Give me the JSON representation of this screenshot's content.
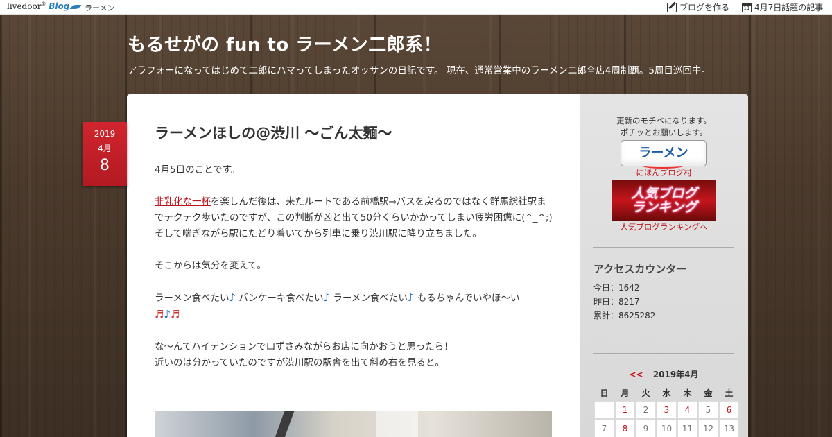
{
  "topbar": {
    "logo_text": "livedoor",
    "logo_blog": "Blog",
    "crumb": "ラーメン",
    "create_blog": "ブログを作る",
    "calendar_icon_day": "11",
    "topics": "4月7日話題の記事"
  },
  "header": {
    "title": "もるせがの fun to ラーメン二郎系！",
    "description": "アラフォーになってはじめて二郎にハマってしまったオッサンの日記です。 現在、通常営業中のラーメン二郎全店4周制覇。5周目巡回中。"
  },
  "date": {
    "year": "2019",
    "month": "4月",
    "day": "8"
  },
  "article": {
    "title": "ラーメンほしの@渋川 〜ごん太麺〜",
    "p1": "4月5日のことです。",
    "link": "非乳化な一杯",
    "p2_rest": "を楽しんだ後は、来たルートである前橋駅→バスを戻るのではなく群馬総社駅までテクテク歩いたのですが、この判断が凶と出て50分くらいかかってしまい疲労困憊に(^_^;)",
    "p3": "そして喘ぎながら駅にたどり着いてから列車に乗り渋川駅に降り立ちました。",
    "p4": "そこからは気分を変えて。",
    "sing1": "ラーメン食べたい",
    "sing2": " パンケーキ食べたい",
    "sing3": " ラーメン食べたい",
    "sing4": " もるちゃんでいやほ〜い",
    "p6": "な〜んてハイテンションで口ずさみながらお店に向かおうと思ったら！",
    "p7": "近いのは分かっていたのですが渋川駅の駅舎を出て斜め右を見ると。"
  },
  "sidebar": {
    "motive_line1": "更新のモチベになります。",
    "motive_line2": "ポチッとお願いします。",
    "ramen_button": "ラーメン",
    "nihon_blog_link": "にほんブログ村",
    "rank_banner_line1": "人気ブログ",
    "rank_banner_line2": "ランキング",
    "rank_link": "人気ブログランキングへ",
    "counter_title": "アクセスカウンター",
    "today": "今日：1642",
    "yesterday": "昨日：8217",
    "total": "累計：8625282",
    "calendar_prev": "<<",
    "calendar_title": "2019年4月",
    "weekdays": [
      "日",
      "月",
      "火",
      "水",
      "木",
      "金",
      "土"
    ],
    "week1": [
      "",
      "1",
      "2",
      "3",
      "4",
      "5",
      "6"
    ],
    "week2": [
      "7",
      "8",
      "9",
      "10",
      "11",
      "12",
      "13"
    ]
  },
  "colors": {
    "accent_red": "#c0141d",
    "date_badge": "#c8202a",
    "wood": "#4b3a2c"
  }
}
